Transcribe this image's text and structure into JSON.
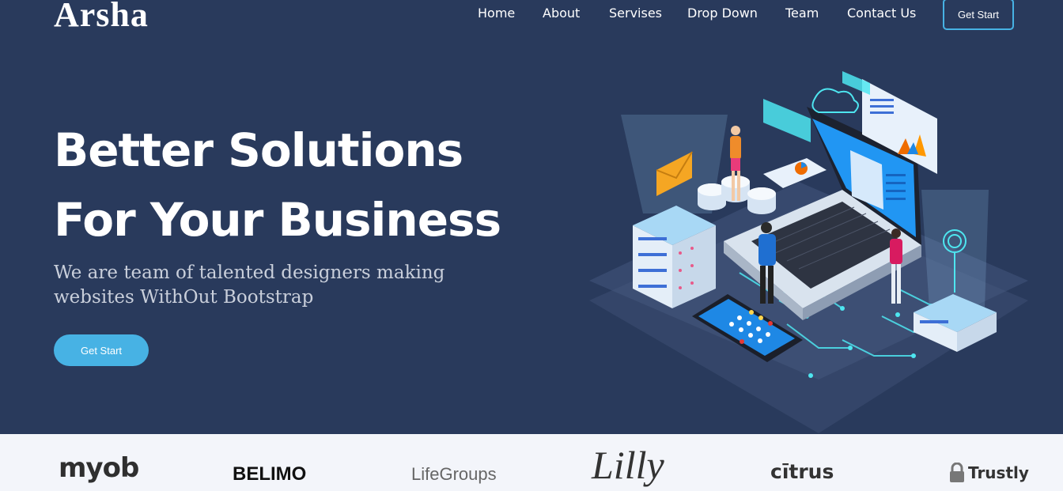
{
  "brand": {
    "logo": "Arsha"
  },
  "nav": {
    "items": [
      "Home",
      "About",
      "Servises",
      "Drop Down",
      "Team",
      "Contact Us"
    ],
    "cta": "Get Start"
  },
  "hero": {
    "headline_line1": "Better Solutions",
    "headline_line2": "For Your Business",
    "subtitle": "We are team of talented designers making websites WithOut Bootstrap",
    "cta": "Get Start",
    "illustration": "isometric-laptop-servers-people-illustration"
  },
  "clients": {
    "logos": [
      "myob",
      "BELIMO",
      "LifeGroups",
      "Lilly",
      "cītrus",
      "Trustly"
    ]
  },
  "colors": {
    "hero_bg": "#293a5c",
    "accent": "#47b2e4",
    "clients_bg": "#f3f5fa"
  }
}
